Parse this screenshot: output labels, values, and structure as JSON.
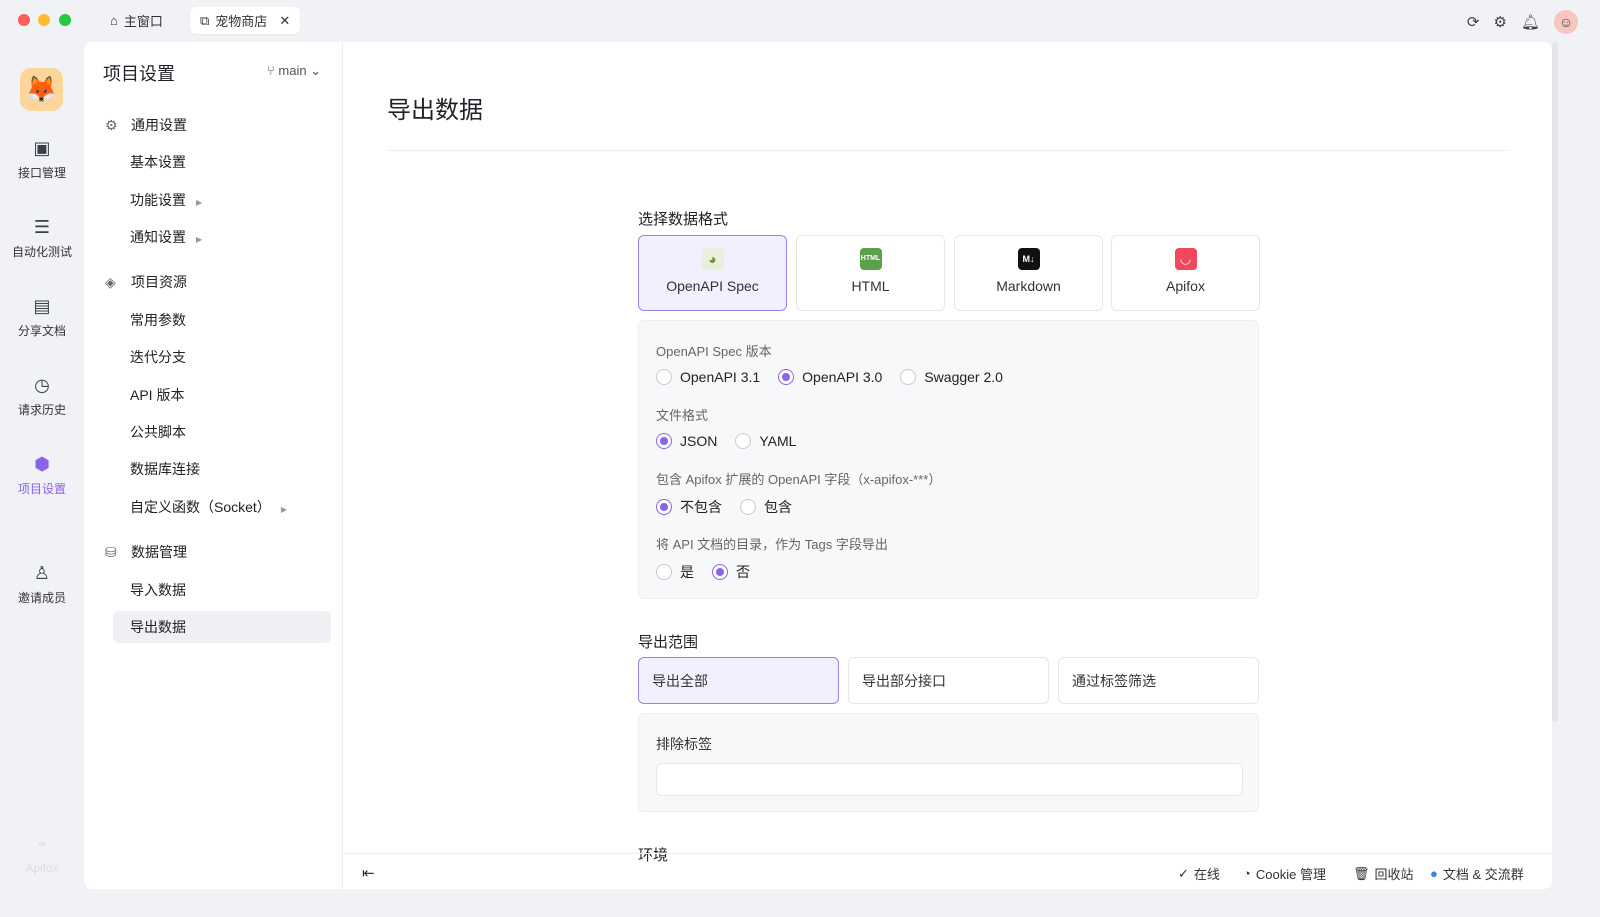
{
  "colors": {
    "accent": "#8a63e8",
    "close": "#fe5f57",
    "minimize": "#febc2e",
    "maximize": "#28c840"
  },
  "tabs": [
    {
      "label": "主窗口",
      "icon": "home-icon"
    },
    {
      "label": "宠物商店",
      "icon": "external-link-icon"
    }
  ],
  "rail": [
    {
      "label": "接口管理"
    },
    {
      "label": "自动化测试"
    },
    {
      "label": "分享文档"
    },
    {
      "label": "请求历史"
    },
    {
      "label": "项目设置"
    },
    {
      "label": "邀请成员"
    }
  ],
  "rail_brand": "Apifox",
  "sidebar": {
    "title": "项目设置",
    "branch": "main",
    "groups": [
      {
        "label": "通用设置",
        "items": [
          "基本设置",
          "功能设置",
          "通知设置"
        ]
      },
      {
        "label": "项目资源",
        "items": [
          "常用参数",
          "迭代分支",
          "API 版本",
          "公共脚本",
          "数据库连接",
          "自定义函数（Socket）"
        ]
      },
      {
        "label": "数据管理",
        "items": [
          "导入数据",
          "导出数据"
        ]
      }
    ]
  },
  "main": {
    "title": "导出数据",
    "format_label": "选择数据格式",
    "formats": [
      {
        "label": "OpenAPI Spec",
        "selected": true
      },
      {
        "label": "HTML"
      },
      {
        "label": "Markdown"
      },
      {
        "label": "Apifox"
      }
    ],
    "options": [
      {
        "label": "OpenAPI Spec 版本",
        "choices": [
          "OpenAPI 3.1",
          "OpenAPI 3.0",
          "Swagger 2.0"
        ],
        "selected": 1
      },
      {
        "label": "文件格式",
        "choices": [
          "JSON",
          "YAML"
        ],
        "selected": 0
      },
      {
        "label": "包含 Apifox 扩展的 OpenAPI 字段（x-apifox-***）",
        "choices": [
          "不包含",
          "包含"
        ],
        "selected": 0
      },
      {
        "label": "将 API 文档的目录，作为 Tags 字段导出",
        "choices": [
          "是",
          "否"
        ],
        "selected": 1
      }
    ],
    "scope_label": "导出范围",
    "scopes": [
      "导出全部",
      "导出部分接口",
      "通过标签筛选"
    ],
    "scope_selected": 0,
    "exclude_label": "排除标签",
    "exclude_value": "",
    "env_label": "环境"
  },
  "footer": {
    "online": "在线",
    "cookie": "Cookie 管理",
    "trash": "回收站",
    "docs": "文档 & 交流群"
  }
}
